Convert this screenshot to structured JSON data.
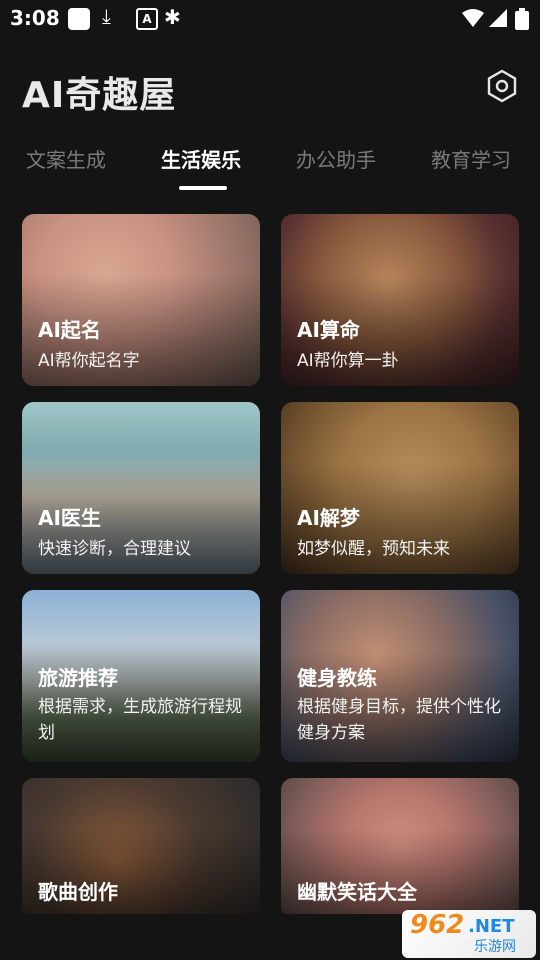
{
  "status_bar": {
    "time": "3:08"
  },
  "header": {
    "app_title": "AI奇趣屋"
  },
  "tabs": [
    {
      "label": "文案生成"
    },
    {
      "label": "生活娱乐"
    },
    {
      "label": "办公助手"
    },
    {
      "label": "教育学习"
    }
  ],
  "active_tab_index": 1,
  "cards": [
    {
      "title": "AI起名",
      "subtitle": "AI帮你起名字"
    },
    {
      "title": "AI算命",
      "subtitle": "AI帮你算一卦"
    },
    {
      "title": "AI医生",
      "subtitle": "快速诊断，合理建议"
    },
    {
      "title": "AI解梦",
      "subtitle": "如梦似醒，预知未来"
    },
    {
      "title": "旅游推荐",
      "subtitle": "根据需求，生成旅游行程规划"
    },
    {
      "title": "健身教练",
      "subtitle": "根据健身目标，提供个性化健身方案"
    },
    {
      "title": "歌曲创作",
      "subtitle": ""
    },
    {
      "title": "幽默笑话大全",
      "subtitle": ""
    }
  ],
  "watermark": {
    "brand_number": "962",
    "brand_suffix": ".NET",
    "brand_cn": "乐游网"
  }
}
